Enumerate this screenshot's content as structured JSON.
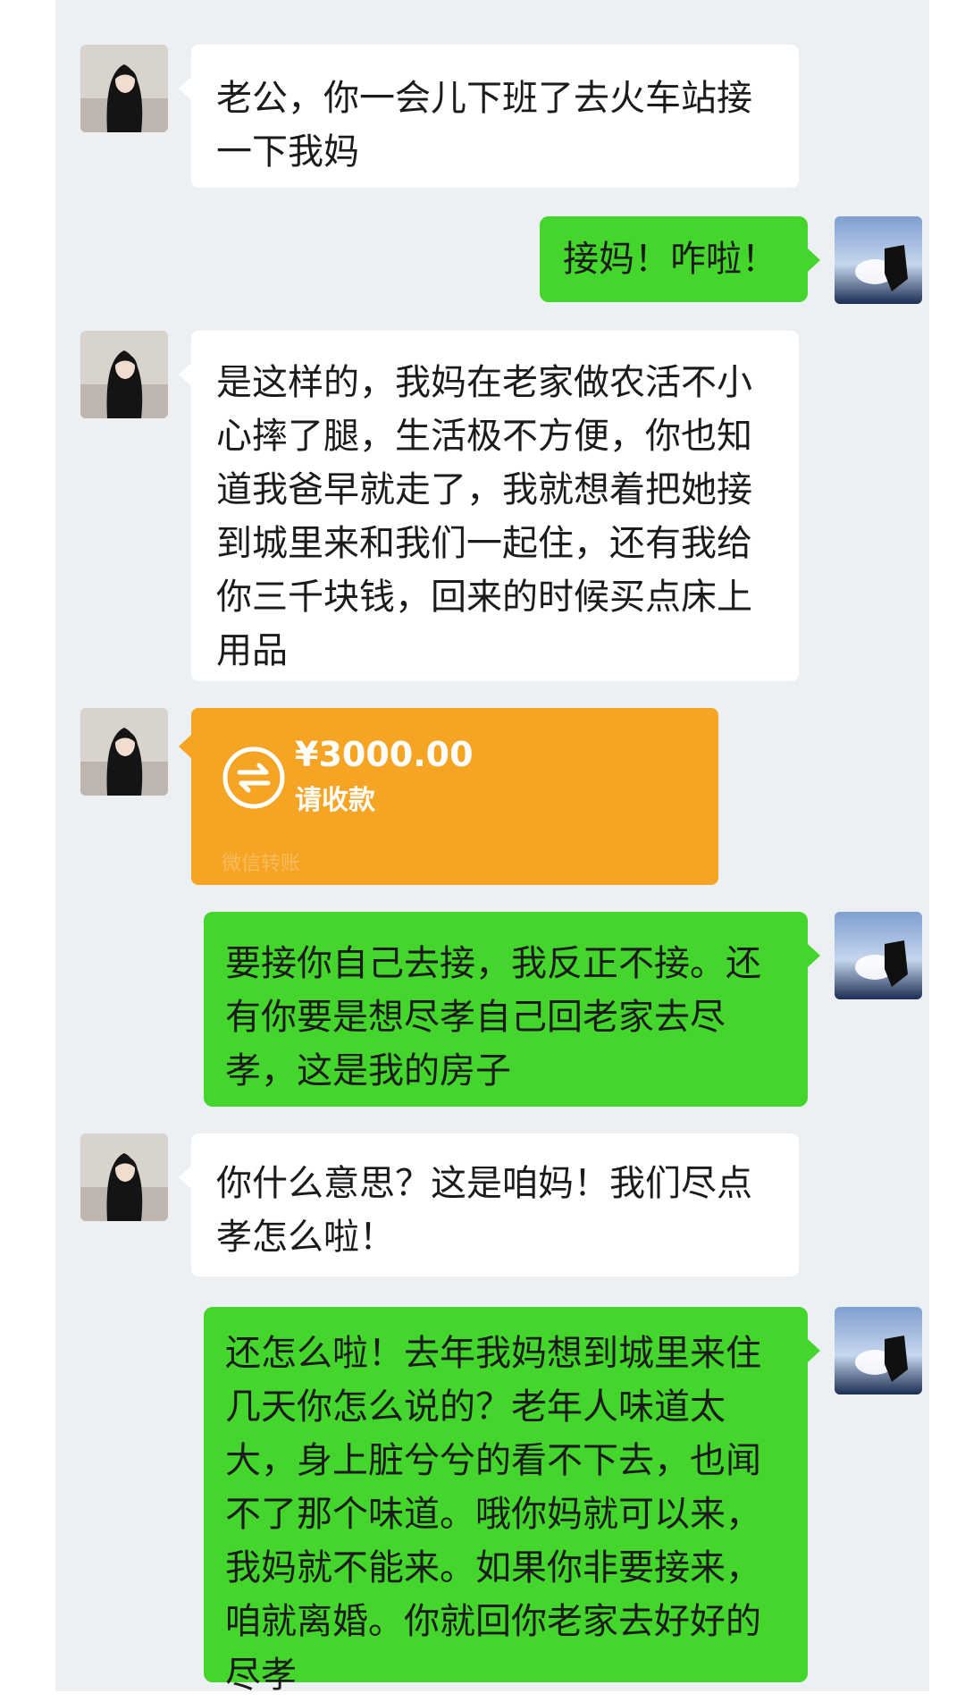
{
  "messages": {
    "m1": {
      "sender": "wife",
      "text": "老公，你一会儿下班了去火车站接\n一下我妈"
    },
    "m2": {
      "sender": "husband",
      "text": "接妈！咋啦！"
    },
    "m3": {
      "sender": "wife",
      "text": "是这样的，我妈在老家做农活不小\n心摔了腿，生活极不方便，你也知\n道我爸早就走了，我就想着把她接\n到城里来和我们一起住，还有我给\n你三千块钱，回来的时候买点床上\n用品"
    },
    "m4": {
      "sender": "husband",
      "text": "要接你自己去接，我反正不接。还\n有你要是想尽孝自己回老家去尽\n孝，这是我的房子"
    },
    "m5": {
      "sender": "wife",
      "text": "你什么意思？这是咱妈！我们尽点\n孝怎么啦！"
    },
    "m6": {
      "sender": "husband",
      "text": "还怎么啦！去年我妈想到城里来住\n几天你怎么说的？老年人味道太\n大，身上脏兮兮的看不下去，也闻\n不了那个味道。哦你妈就可以来，\n我妈就不能来。如果你非要接来，\n咱就离婚。你就回你老家去好好的\n尽孝"
    }
  },
  "transfer": {
    "amount": "¥3000.00",
    "status": "请收款",
    "footer": "微信转账",
    "icon": "transfer-arrows-icon",
    "color": "#f6a423"
  },
  "colors": {
    "background": "#edf0f3",
    "incoming_bubble": "#ffffff",
    "outgoing_bubble": "#44d62c"
  }
}
